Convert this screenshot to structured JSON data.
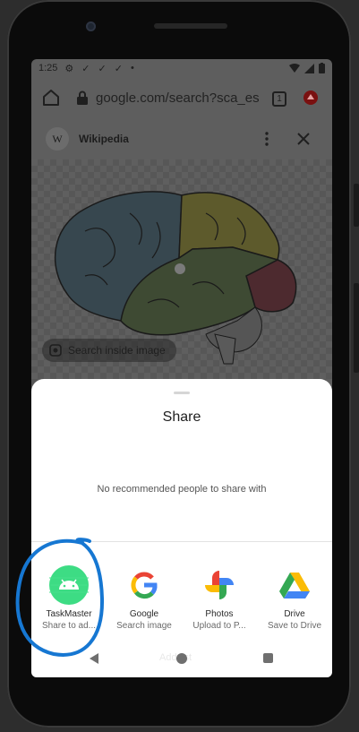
{
  "status_bar": {
    "time": "1:25",
    "icons": [
      "gear-icon",
      "check-icon",
      "check-icon",
      "check-icon",
      "dot-icon"
    ]
  },
  "browser": {
    "url": "google.com/search?sca_es",
    "tab_count": "1"
  },
  "lens": {
    "source_logo": "W",
    "source_title": "Wikipedia",
    "search_inside_label": "Search inside image"
  },
  "share_sheet": {
    "title": "Share",
    "no_recommendations": "No recommended people to share with",
    "apps": [
      {
        "name": "TaskMaster",
        "subtitle": "Share to ad...",
        "icon": "android-icon",
        "color": "#3ddc84"
      },
      {
        "name": "Google",
        "subtitle": "Search image",
        "icon": "google-g-icon"
      },
      {
        "name": "Photos",
        "subtitle": "Upload to P...",
        "icon": "photos-pinwheel-icon"
      },
      {
        "name": "Drive",
        "subtitle": "Save to Drive",
        "icon": "drive-icon"
      }
    ],
    "ghost_text": "Add list"
  },
  "annotation_color": "#1677d2"
}
